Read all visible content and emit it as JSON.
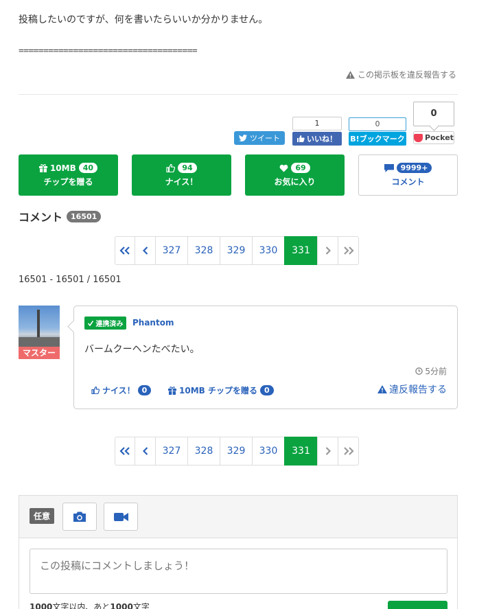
{
  "post": {
    "text": "投稿したいのですが、何を書いたらいいか分かりません。",
    "separator": "====================================",
    "report_board": "この掲示板を違反報告する"
  },
  "social": {
    "tweet": "ツイート",
    "fb_count": "1",
    "fb_like": "いいね！",
    "hatena_count": "0",
    "hatena_label": "B!ブックマーク",
    "pocket_count": "0",
    "pocket_label": "Pocket"
  },
  "actions": {
    "chip": {
      "size": "10MB",
      "count": "40",
      "label": "チップを贈る"
    },
    "nice": {
      "count": "94",
      "label": "ナイス！"
    },
    "favorite": {
      "count": "69",
      "label": "お気に入り"
    },
    "comment": {
      "count": "9999+",
      "label": "コメント"
    }
  },
  "comments": {
    "heading": "コメント",
    "count": "16501",
    "range": "16501 - 16501 / 16501"
  },
  "pagination": {
    "first": "«",
    "prev": "‹",
    "pages": [
      "327",
      "328",
      "329",
      "330",
      "331"
    ],
    "current": "331",
    "next": "›",
    "last": "»"
  },
  "comment_item": {
    "avatar_tag": "マスター",
    "verified": "連携済み",
    "username": "Phantom",
    "body": "バームクーヘンたべたい。",
    "time": "5分前",
    "nice_label": "ナイス！",
    "nice_count": "0",
    "chip_label": "10MB チップを贈る",
    "chip_count": "0",
    "report": "違反報告する"
  },
  "form": {
    "optional": "任意",
    "placeholder": "この投稿にコメントしましょう！",
    "limit_prefix": "1000",
    "limit_mid": "文字以内、あと",
    "limit_remaining": "1000",
    "limit_suffix": "文字"
  },
  "colors": {
    "green": "#0aa340",
    "blue": "#2962ba",
    "master_tag": "#ef6b6b"
  },
  "icons": [
    "warning-icon",
    "twitter-icon",
    "thumbs-up-icon",
    "pocket-icon",
    "gift-icon",
    "heart-icon",
    "comment-icon",
    "check-icon",
    "clock-icon",
    "camera-icon",
    "video-icon",
    "double-chevron-left-icon",
    "chevron-left-icon",
    "chevron-right-icon",
    "double-chevron-right-icon"
  ]
}
